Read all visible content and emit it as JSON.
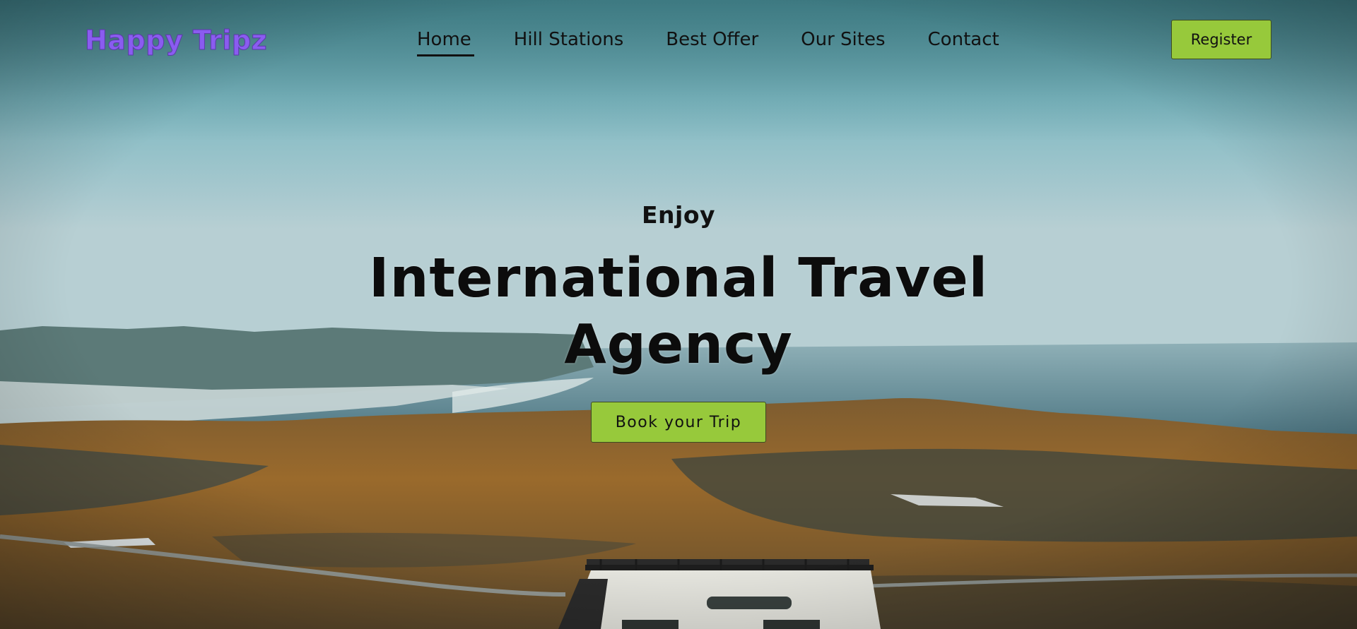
{
  "header": {
    "logo": "Happy Tripz",
    "nav": [
      {
        "label": "Home",
        "active": true
      },
      {
        "label": "Hill Stations",
        "active": false
      },
      {
        "label": "Best Offer",
        "active": false
      },
      {
        "label": "Our Sites",
        "active": false
      },
      {
        "label": "Contact",
        "active": false
      }
    ],
    "register_label": "Register"
  },
  "hero": {
    "kicker": "Enjoy",
    "title": "International Travel Agency",
    "cta_label": "Book your Trip"
  },
  "colors": {
    "accent": "#97c93b",
    "logo": "#8a5cf0",
    "text": "#111111"
  }
}
